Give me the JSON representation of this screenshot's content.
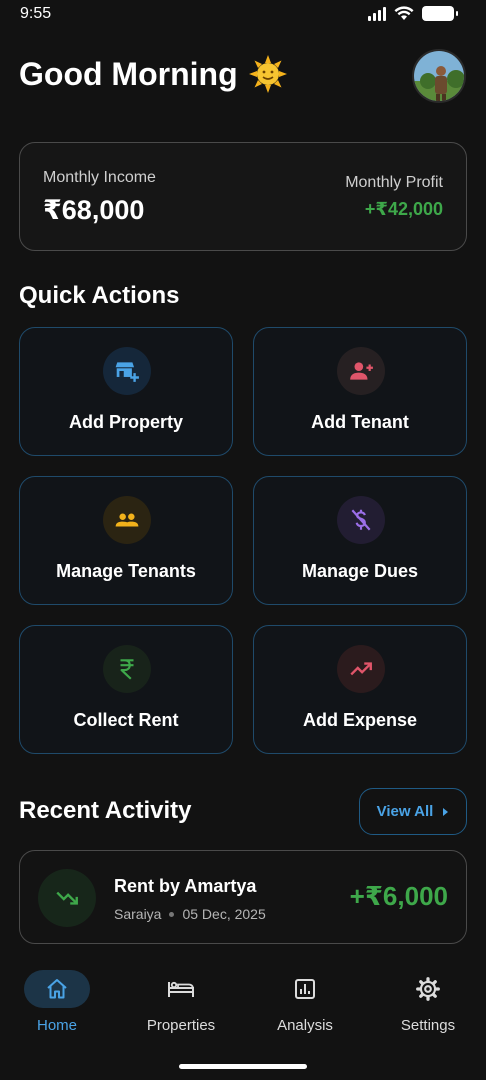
{
  "status_bar": {
    "time": "9:55"
  },
  "header": {
    "greeting": "Good Morning",
    "greeting_emoji": "🌞",
    "avatar_icon": "user-avatar"
  },
  "summary": {
    "income_label": "Monthly Income",
    "income_value": "₹68,000",
    "profit_label": "Monthly Profit",
    "profit_value": "+₹42,000"
  },
  "quick_actions": {
    "title": "Quick Actions",
    "items": [
      {
        "label": "Add Property",
        "icon": "add-store-icon",
        "color": "#4aa3e6"
      },
      {
        "label": "Add Tenant",
        "icon": "person-add-icon",
        "color": "#e0556a"
      },
      {
        "label": "Manage Tenants",
        "icon": "group-icon",
        "color": "#f2b21b"
      },
      {
        "label": "Manage Dues",
        "icon": "money-off-icon",
        "color": "#9b6ee8"
      },
      {
        "label": "Collect Rent",
        "icon": "rupee-icon",
        "color": "#3ea84a"
      },
      {
        "label": "Add Expense",
        "icon": "trending-up-icon",
        "color": "#e0556a"
      }
    ]
  },
  "recent_activity": {
    "title": "Recent Activity",
    "view_all_label": "View All",
    "items": [
      {
        "title": "Rent by Amartya",
        "property": "Saraiya",
        "date": "05 Dec, 2025",
        "amount": "+₹6,000",
        "icon": "trending-down-icon"
      }
    ]
  },
  "bottom_nav": {
    "items": [
      {
        "label": "Home",
        "icon": "home-icon",
        "active": true
      },
      {
        "label": "Properties",
        "icon": "bed-icon",
        "active": false
      },
      {
        "label": "Analysis",
        "icon": "analytics-icon",
        "active": false
      },
      {
        "label": "Settings",
        "icon": "gear-icon",
        "active": false
      }
    ]
  },
  "colors": {
    "accent": "#4aa3e6",
    "positive": "#3ea84a",
    "background": "#121212"
  }
}
